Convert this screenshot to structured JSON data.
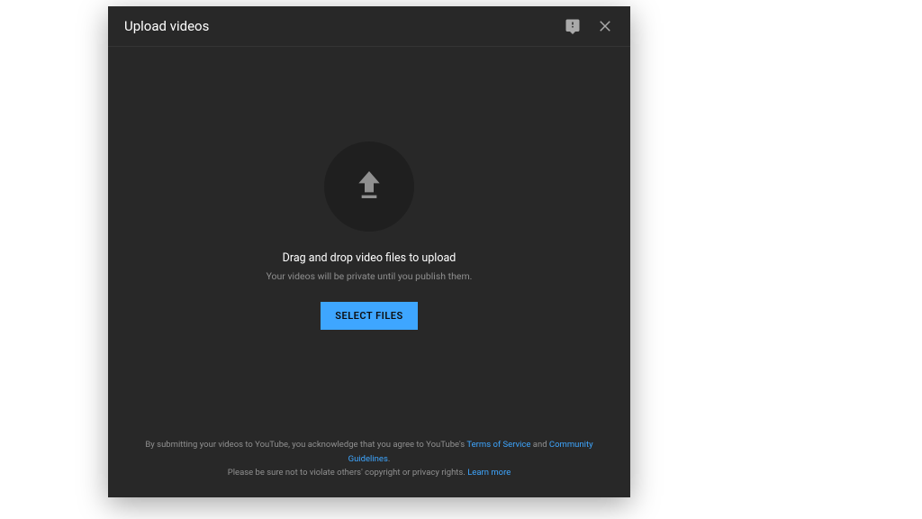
{
  "dialog": {
    "title": "Upload videos",
    "upload": {
      "primary": "Drag and drop video files to upload",
      "secondary": "Your videos will be private until you publish them.",
      "button": "SELECT FILES"
    },
    "footer": {
      "line1_pre": "By submitting your videos to YouTube, you acknowledge that you agree to YouTube's ",
      "tos": "Terms of Service",
      "and": " and ",
      "guidelines": "Community Guidelines",
      "line1_post": ".",
      "line2_pre": "Please be sure not to violate others' copyright or privacy rights. ",
      "learn_more": "Learn more"
    }
  }
}
